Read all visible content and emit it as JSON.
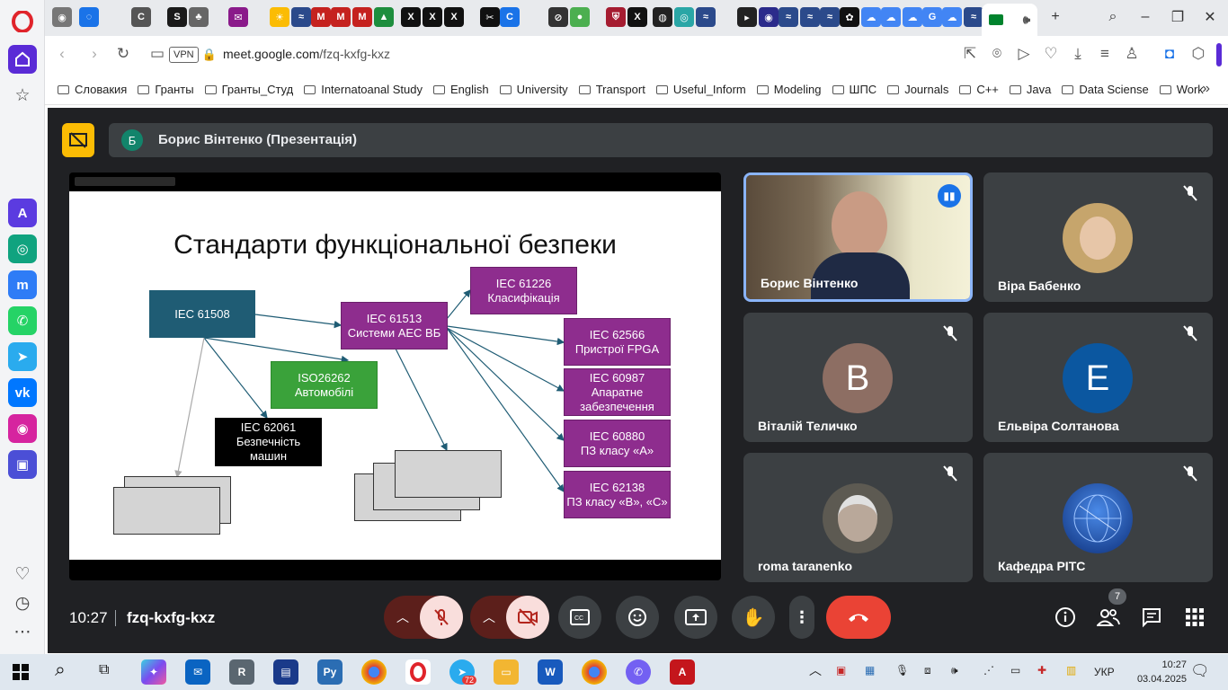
{
  "browser": {
    "address": {
      "vpn_label": "VPN",
      "url_host": "meet.google.com",
      "url_path": "/fzq-kxfg-kxz"
    },
    "bookmarks": [
      "Словакия",
      "Гранты",
      "Гранты_Студ",
      "Internatoanal Study",
      "English",
      "University",
      "Transport",
      "Useful_Inform",
      "Modeling",
      "ШПС",
      "Journals",
      "C++",
      "Java",
      "Data Sciense",
      "Work"
    ]
  },
  "meet": {
    "presenter_initial": "Б",
    "presenter_title": "Борис Вінтенко (Презентація)",
    "time": "10:27",
    "meeting_code": "fzq-kxfg-kxz",
    "people_count": "7",
    "participants": [
      {
        "name": "Борис Вінтенко",
        "initial": "",
        "color": "#6b5b4b",
        "speaking": true
      },
      {
        "name": "Віра Бабенко",
        "initial": "",
        "color": "#c6a56c",
        "speaking": false
      },
      {
        "name": "Віталій Теличко",
        "initial": "B",
        "color": "#8d6e63",
        "speaking": false
      },
      {
        "name": "Ельвіра Солтанова",
        "initial": "E",
        "color": "#0b57a0",
        "speaking": false
      },
      {
        "name": "roma taranenko",
        "initial": "",
        "color": "#5d5a52",
        "speaking": false
      },
      {
        "name": "Кафедра РІТС",
        "initial": "",
        "color": "#1d4fa8",
        "speaking": false
      }
    ]
  },
  "slide": {
    "title": "Стандарти функціональної безпеки",
    "boxes": {
      "iec61508": "IEC 61508",
      "iec61513_line1": "IEC 61513",
      "iec61513_line2": "Системи АЕС ВБ",
      "iec61226_line1": "IEC 61226",
      "iec61226_line2": "Класифікація",
      "iec62566_line1": "IEC 62566",
      "iec62566_line2": "Пристрої FPGA",
      "iec60987_line1": "IEC 60987",
      "iec60987_line2": "Апаратне",
      "iec60987_line3": "забезпечення",
      "iec60880_line1": "IEC 60880",
      "iec60880_line2": "ПЗ класу «А»",
      "iec62138_line1": "IEC 62138",
      "iec62138_line2": "ПЗ класу «В», «С»",
      "iso26262_line1": "ISO26262",
      "iso26262_line2": "Автомобілі",
      "iec62061_line1": "IEC 62061",
      "iec62061_line2": "Безпечність",
      "iec62061_line3": "машин"
    }
  },
  "taskbar": {
    "lang": "УКР",
    "clock_time": "10:27",
    "clock_date": "03.04.2025",
    "telegram_badge": "72"
  }
}
